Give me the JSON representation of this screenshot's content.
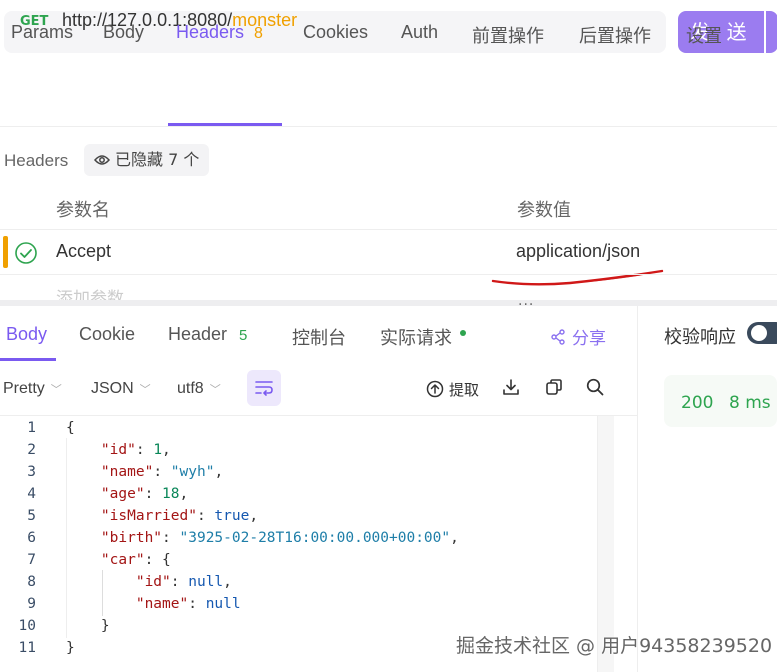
{
  "request": {
    "method": "GET",
    "url_base": "http://127.0.0.1:8080/",
    "url_path": "monster",
    "send_label": "发 送"
  },
  "request_tabs": [
    {
      "label": "Params"
    },
    {
      "label": "Body"
    },
    {
      "label": "Headers",
      "count": "8",
      "active": true
    },
    {
      "label": "Cookies"
    },
    {
      "label": "Auth"
    },
    {
      "label": "前置操作"
    },
    {
      "label": "后置操作"
    },
    {
      "label": "设置"
    }
  ],
  "headers_section": {
    "title": "Headers",
    "hidden_label": "已隐藏 7 个",
    "col_name": "参数名",
    "col_value": "参数值",
    "rows": [
      {
        "name": "Accept",
        "value": "application/json",
        "enabled": true
      }
    ],
    "add_placeholder": "添加参数",
    "more": "..."
  },
  "response_tabs": [
    {
      "label": "Body",
      "active": true
    },
    {
      "label": "Cookie"
    },
    {
      "label": "Header",
      "count": "5"
    },
    {
      "label": "控制台"
    },
    {
      "label": "实际请求",
      "dot": true
    }
  ],
  "share_label": "分享",
  "validate_label": "校验响应",
  "status": {
    "code": "200",
    "time": "8 ms"
  },
  "format": {
    "mode": "Pretty",
    "type": "JSON",
    "encoding": "utf8",
    "extract_label": "提取"
  },
  "code_lines": [
    "{",
    "    \"id\": 1,",
    "    \"name\": \"wyh\",",
    "    \"age\": 18,",
    "    \"isMarried\": true,",
    "    \"birth\": \"3925-02-28T16:00:00.000+00:00\",",
    "    \"car\": {",
    "        \"id\": null,",
    "        \"name\": null",
    "    }",
    "}"
  ],
  "watermark": "掘金技术社区 @ 用户94358239520",
  "colors": {
    "accent": "#7a5af0",
    "send_button": "#9b7cf0",
    "method": "#2ea44f",
    "url_path": "#f0a000",
    "annotation": "#d01818"
  }
}
